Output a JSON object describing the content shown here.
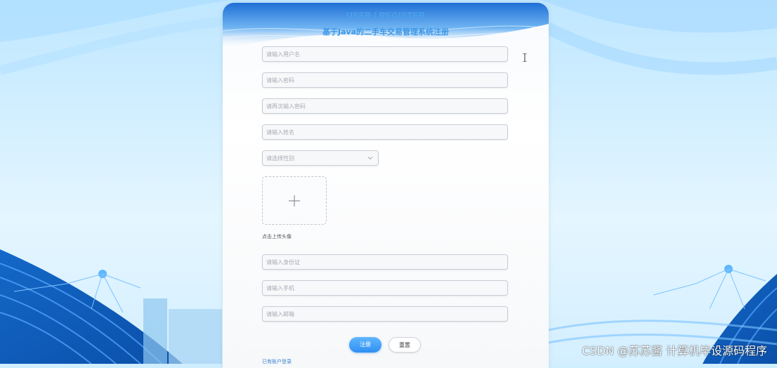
{
  "header": {
    "title_en": "USER / REGISTER",
    "title_cn": "基于Java的二手车交易管理系统注册"
  },
  "form": {
    "username_placeholder": "请输入用户名",
    "password_placeholder": "请输入密码",
    "password_confirm_placeholder": "请再次输入密码",
    "name_placeholder": "请输入姓名",
    "gender_placeholder": "请选择性别",
    "avatar_label": "点击上传头像",
    "id_card_placeholder": "请输入身份证",
    "phone_placeholder": "请输入手机",
    "email_placeholder": "请输入邮箱"
  },
  "buttons": {
    "register_label": "注册",
    "reset_label": "重置",
    "login_link": "已有账户登录"
  },
  "watermark": "CSDN @苏苏酱     计算机毕设源码程序",
  "colors": {
    "accent": "#3d97e6",
    "primary_button": "#2f8ff2"
  }
}
